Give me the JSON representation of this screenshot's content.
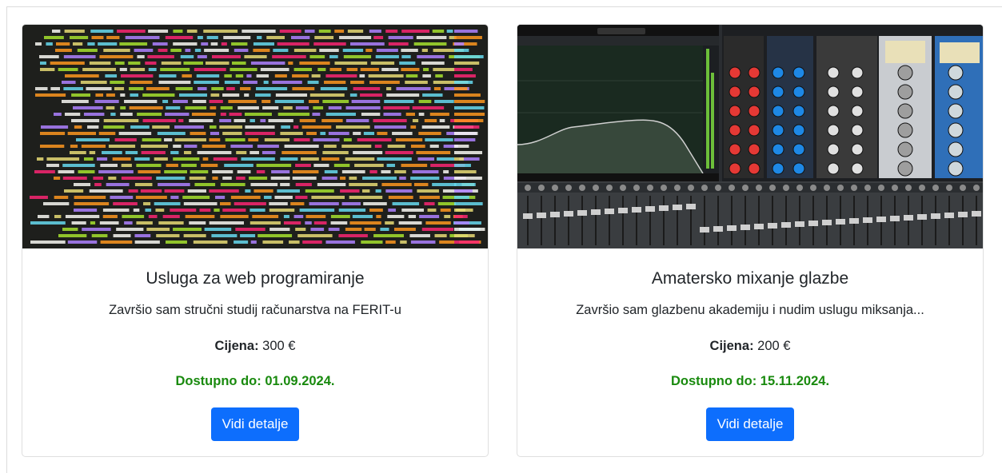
{
  "colors": {
    "primary": "#0d6efd",
    "available": "#198a0e",
    "code_bg": "#1e1f1c"
  },
  "cards": [
    {
      "image": "code-screenshot",
      "title": "Usluga za web programiranje",
      "description": "Završio sam stručni studij računarstva na FERIT-u",
      "price_label": "Cijena:",
      "price_value": "300 €",
      "available": "Dostupno do: 01.09.2024.",
      "button": "Vidi detalje"
    },
    {
      "image": "mixing-console-screenshot",
      "title": "Amatersko mixanje glazbe",
      "description": "Završio sam glazbenu akademiju i nudim uslugu miksanja...",
      "price_label": "Cijena:",
      "price_value": "200 €",
      "available": "Dostupno do: 15.11.2024.",
      "button": "Vidi detalje"
    }
  ]
}
